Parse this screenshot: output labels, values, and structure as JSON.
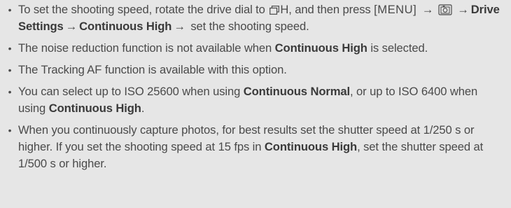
{
  "notes": [
    {
      "bullet": "•",
      "a": "To set the shooting speed, rotate the drive dial to ",
      "drive_mode_suffix": "H",
      "b": ", and then press ",
      "menu_key": "[MENU]",
      "arrow": "→",
      "menu_path_1": "Drive Settings",
      "menu_path_2": "Continuous High",
      "c": " set the shooting speed."
    },
    {
      "bullet": "•",
      "a": "The noise reduction function is not available when ",
      "bold": "Continuous High",
      "b": " is selected."
    },
    {
      "bullet": "•",
      "a": "The Tracking AF function is available with this option."
    },
    {
      "bullet": "•",
      "a": "You can select up to ISO 25600 when using ",
      "bold1": "Continuous Normal",
      "b": ", or up to ISO 6400 when using ",
      "bold2": "Continuous High",
      "c": "."
    },
    {
      "bullet": "•",
      "a": "When you continuously capture photos, for best results set the shutter speed at 1/250 s or higher. If you set the shooting speed at 15 fps in ",
      "bold": "Continuous High",
      "b": ", set the shutter speed at 1/500 s or higher."
    }
  ],
  "icons": {
    "drive": "continuous-drive-icon",
    "camera": "shooting-menu-camera-icon"
  },
  "colors": {
    "background": "#e6e6e6",
    "text": "#4a4a4a"
  }
}
